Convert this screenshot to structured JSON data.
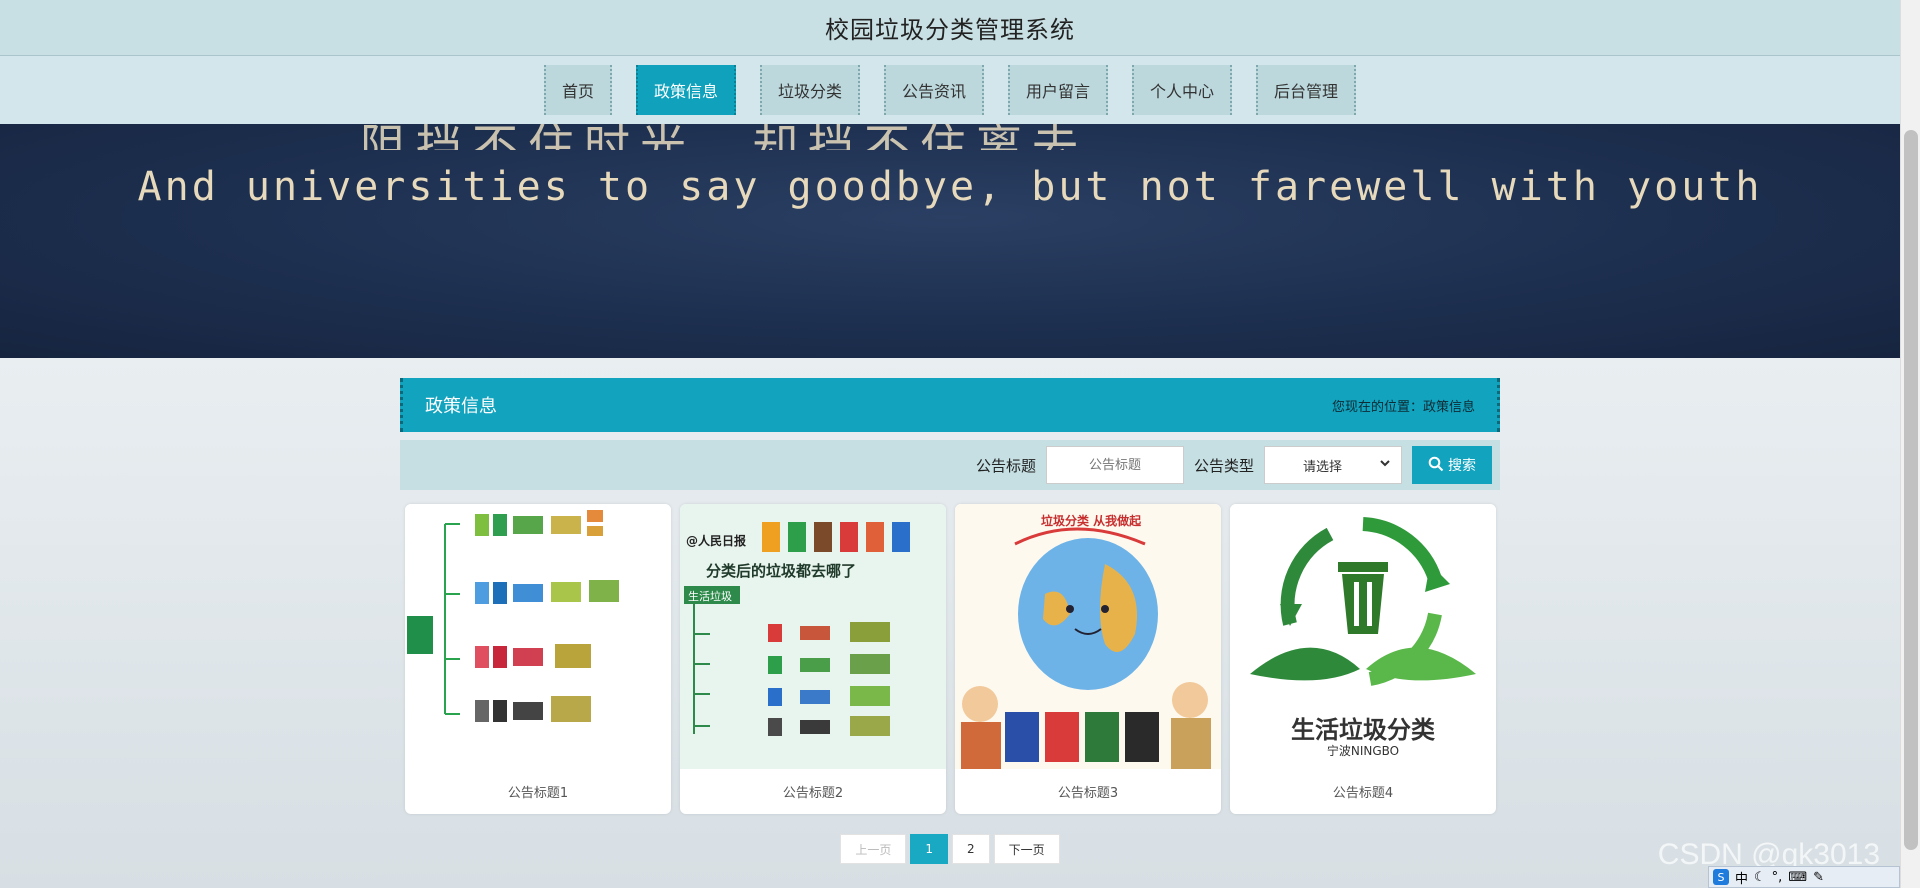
{
  "site": {
    "title": "校园垃圾分类管理系统"
  },
  "nav": {
    "items": [
      {
        "label": "首页"
      },
      {
        "label": "政策信息"
      },
      {
        "label": "垃圾分类"
      },
      {
        "label": "公告资讯"
      },
      {
        "label": "用户留言"
      },
      {
        "label": "个人中心"
      },
      {
        "label": "后台管理"
      }
    ],
    "active": "政策信息"
  },
  "banner": {
    "line1": "阻挡不住时光，却挡不住离去",
    "line2": "And universities to say goodbye, but not farewell with youth"
  },
  "section": {
    "title": "政策信息",
    "breadcrumb_prefix": "您现在的位置：",
    "breadcrumb_current": "政策信息"
  },
  "search": {
    "title_label": "公告标题",
    "title_placeholder": "公告标题",
    "type_label": "公告类型",
    "type_selected": "请选择",
    "button_label": "搜索"
  },
  "cards": [
    {
      "title": "公告标题1",
      "image": "garbage-flow-chart"
    },
    {
      "title": "公告标题2",
      "image": "people-daily-garbage-infographic",
      "overlay_brand": "@人民日报",
      "overlay_heading": "分类后的垃圾都去哪了",
      "overlay_tag": "生活垃圾"
    },
    {
      "title": "公告标题3",
      "image": "earth-garbage-cartoon",
      "overlay_heading": "垃圾分类 从我做起"
    },
    {
      "title": "公告标题4",
      "image": "recycle-logo",
      "overlay_heading": "生活垃圾分类",
      "overlay_sub": "宁波NINGBO"
    }
  ],
  "pagination": {
    "prev": "上一页",
    "pages": [
      "1",
      "2"
    ],
    "current": "1",
    "next": "下一页"
  },
  "watermark": "CSDN @qk3013",
  "ime": {
    "mode": "中"
  },
  "colors": {
    "accent": "#12a3bf",
    "header_bg": "#c8e0e4",
    "banner_bg": "#1d2f4f"
  }
}
